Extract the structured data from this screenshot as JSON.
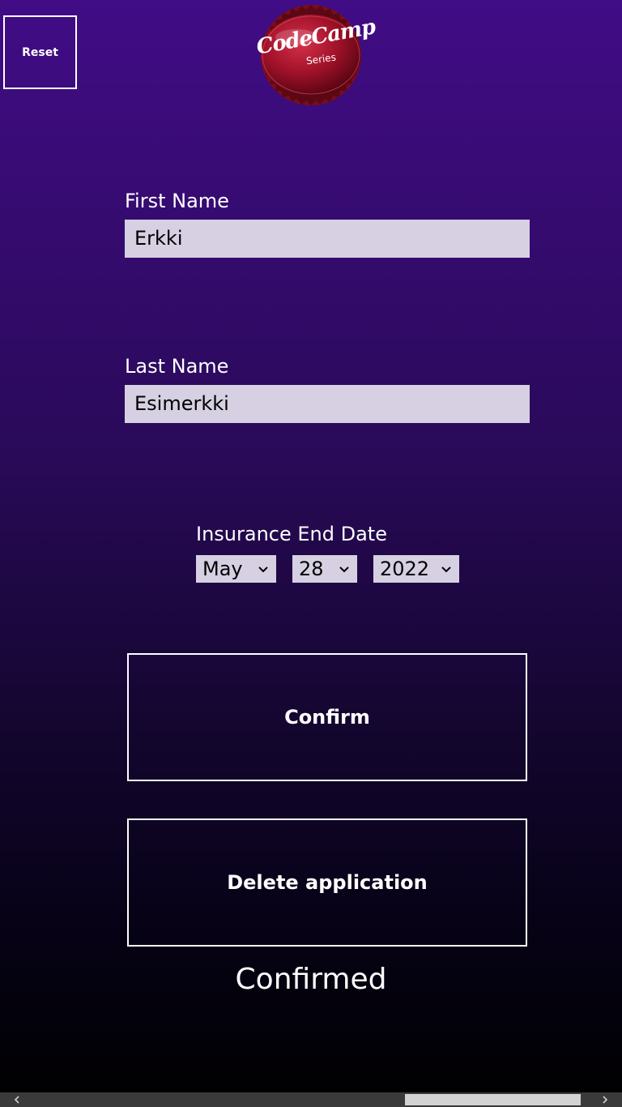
{
  "header": {
    "reset_label": "Reset",
    "logo_text": "CodeCamp",
    "logo_subtext": "Series"
  },
  "form": {
    "first_name": {
      "label": "First Name",
      "value": "Erkki"
    },
    "last_name": {
      "label": "Last Name",
      "value": "Esimerkki"
    },
    "insurance_end_date": {
      "label": "Insurance End Date",
      "month": "May",
      "day": "28",
      "year": "2022"
    }
  },
  "actions": {
    "confirm_label": "Confirm",
    "delete_label": "Delete application"
  },
  "status": {
    "text": "Confirmed"
  },
  "icons": {
    "chevron": "chevron-down-icon",
    "scroll_left": "chevron-left-icon",
    "scroll_right": "chevron-right-icon"
  },
  "colors": {
    "bg_top": "#410c86",
    "bg_bottom": "#000000",
    "input_bg": "#d6d0e2",
    "logo_red": "#a3122a"
  }
}
